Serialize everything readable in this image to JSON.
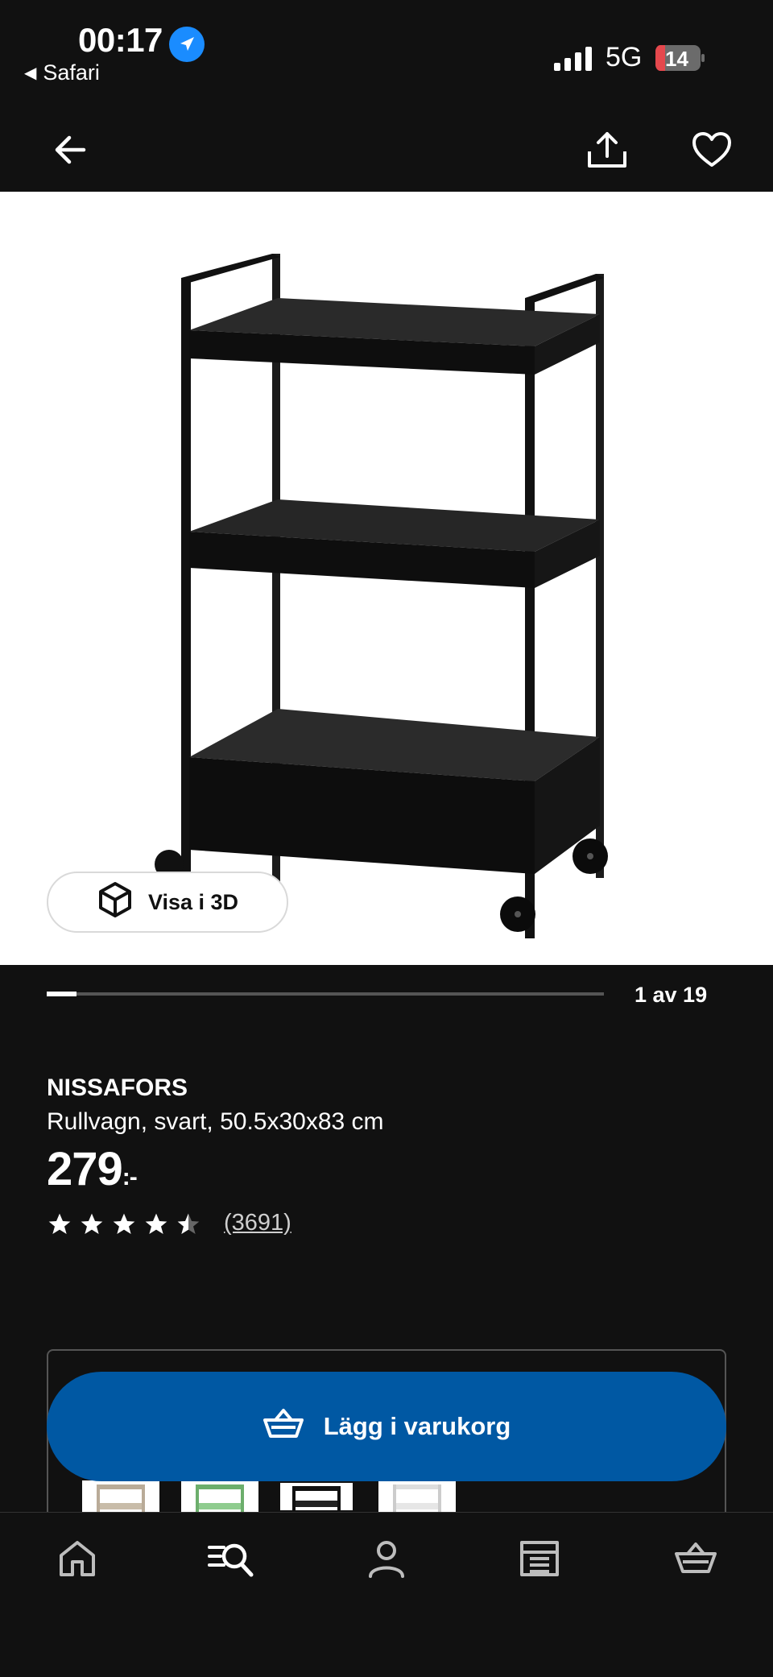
{
  "status_bar": {
    "time": "00:17",
    "back_app": "Safari",
    "network": "5G",
    "battery": "14"
  },
  "top_bar": {
    "back_icon": "arrow-left-icon",
    "share_icon": "share-icon",
    "favorite_icon": "heart-icon"
  },
  "gallery": {
    "view_3d_label": "Visa i 3D",
    "page_indicator": "1 av 19",
    "progress_fraction": 0.053
  },
  "product": {
    "name": "NISSAFORS",
    "description": "Rullvagn, svart, 50.5x30x83 cm",
    "price": "279",
    "price_suffix": ":-",
    "rating": 4.5,
    "rating_count": "(3691)"
  },
  "cart_button": {
    "label": "Lägg i varukorg"
  },
  "colors": {
    "background": "#111111",
    "accent_blue": "#0058a3",
    "nav_blue": "#1a8cff",
    "battery_red": "#e5484d"
  },
  "bottom_nav": {
    "items": [
      "home-icon",
      "search-icon",
      "profile-icon",
      "store-icon",
      "cart-icon"
    ]
  }
}
